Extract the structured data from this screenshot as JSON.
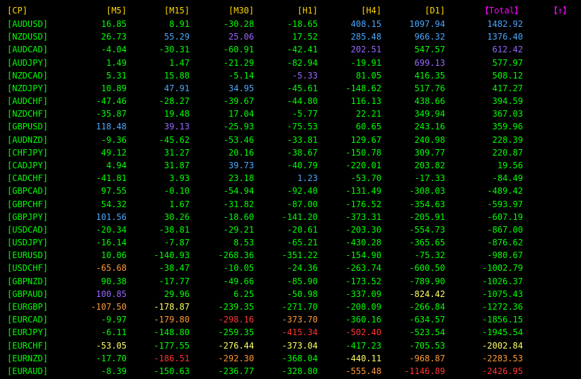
{
  "colors": {
    "header": "#ffd700",
    "symbol": "#00ff00",
    "total_header": "#ff00ff",
    "button": "#ff00ff",
    "strong_up": "#4aa8ff",
    "up": "#9966ff",
    "neutral": "#00ff00",
    "down": "#ffff66",
    "weak_down": "#ff9933",
    "strong_down": "#ff3333"
  },
  "header": {
    "symbol": "[CP]",
    "m5": "[M5]",
    "m15": "[M15]",
    "m30": "[M30]",
    "h1": "[H1]",
    "h4": "[H4]",
    "d1": "[D1]",
    "total": "【Total】",
    "button": "【↑】"
  },
  "rows": [
    {
      "symbol": "[AUDUSD]",
      "m5": "16.85",
      "m15": "8.91",
      "m30": "-30.28",
      "h1": "-18.65",
      "h4": "408.15",
      "d1": "1097.94",
      "total": "1482.92",
      "colors": {
        "m5": "neutral",
        "m15": "neutral",
        "m30": "neutral",
        "h1": "neutral",
        "h4": "strong_up",
        "d1": "strong_up",
        "total": "strong_up"
      }
    },
    {
      "symbol": "[NZDUSD]",
      "m5": "26.73",
      "m15": "55.29",
      "m30": "25.06",
      "h1": "17.52",
      "h4": "285.48",
      "d1": "966.32",
      "total": "1376.40",
      "colors": {
        "m5": "neutral",
        "m15": "strong_up",
        "m30": "up",
        "h1": "neutral",
        "h4": "strong_up",
        "d1": "strong_up",
        "total": "strong_up"
      }
    },
    {
      "symbol": "[AUDCAD]",
      "m5": "-4.04",
      "m15": "-30.31",
      "m30": "-60.91",
      "h1": "-42.41",
      "h4": "202.51",
      "d1": "547.57",
      "total": "612.42",
      "colors": {
        "m5": "neutral",
        "m15": "neutral",
        "m30": "neutral",
        "h1": "neutral",
        "h4": "up",
        "d1": "neutral",
        "total": "up"
      }
    },
    {
      "symbol": "[AUDJPY]",
      "m5": "1.49",
      "m15": "1.47",
      "m30": "-21.29",
      "h1": "-82.94",
      "h4": "-19.91",
      "d1": "699.13",
      "total": "577.97",
      "colors": {
        "m5": "neutral",
        "m15": "neutral",
        "m30": "neutral",
        "h1": "neutral",
        "h4": "neutral",
        "d1": "up",
        "total": "neutral"
      }
    },
    {
      "symbol": "[NZDCAD]",
      "m5": "5.31",
      "m15": "15.88",
      "m30": "-5.14",
      "h1": "-5.33",
      "h4": "81.05",
      "d1": "416.35",
      "total": "508.12",
      "colors": {
        "m5": "neutral",
        "m15": "neutral",
        "m30": "neutral",
        "h1": "up",
        "h4": "neutral",
        "d1": "neutral",
        "total": "neutral"
      }
    },
    {
      "symbol": "[NZDJPY]",
      "m5": "10.89",
      "m15": "47.91",
      "m30": "34.95",
      "h1": "-45.61",
      "h4": "-148.62",
      "d1": "517.76",
      "total": "417.27",
      "colors": {
        "m5": "neutral",
        "m15": "strong_up",
        "m30": "strong_up",
        "h1": "neutral",
        "h4": "neutral",
        "d1": "neutral",
        "total": "neutral"
      }
    },
    {
      "symbol": "[AUDCHF]",
      "m5": "-47.46",
      "m15": "-28.27",
      "m30": "-39.67",
      "h1": "-44.80",
      "h4": "116.13",
      "d1": "438.66",
      "total": "394.59",
      "colors": {
        "m5": "neutral",
        "m15": "neutral",
        "m30": "neutral",
        "h1": "neutral",
        "h4": "neutral",
        "d1": "neutral",
        "total": "neutral"
      }
    },
    {
      "symbol": "[NZDCHF]",
      "m5": "-35.87",
      "m15": "19.48",
      "m30": "17.04",
      "h1": "-5.77",
      "h4": "22.21",
      "d1": "349.94",
      "total": "367.03",
      "colors": {
        "m5": "neutral",
        "m15": "neutral",
        "m30": "neutral",
        "h1": "neutral",
        "h4": "neutral",
        "d1": "neutral",
        "total": "neutral"
      }
    },
    {
      "symbol": "[GBPUSD]",
      "m5": "118.48",
      "m15": "39.13",
      "m30": "-25.93",
      "h1": "-75.53",
      "h4": "60.65",
      "d1": "243.16",
      "total": "359.96",
      "colors": {
        "m5": "strong_up",
        "m15": "up",
        "m30": "neutral",
        "h1": "neutral",
        "h4": "neutral",
        "d1": "neutral",
        "total": "neutral"
      }
    },
    {
      "symbol": "[AUDNZD]",
      "m5": "-9.36",
      "m15": "-45.62",
      "m30": "-53.46",
      "h1": "-33.81",
      "h4": "129.67",
      "d1": "240.98",
      "total": "228.39",
      "colors": {
        "m5": "neutral",
        "m15": "neutral",
        "m30": "neutral",
        "h1": "neutral",
        "h4": "neutral",
        "d1": "neutral",
        "total": "neutral"
      }
    },
    {
      "symbol": "[CHFJPY]",
      "m5": "49.12",
      "m15": "31.27",
      "m30": "20.16",
      "h1": "-38.67",
      "h4": "-150.78",
      "d1": "309.77",
      "total": "220.87",
      "colors": {
        "m5": "neutral",
        "m15": "neutral",
        "m30": "neutral",
        "h1": "neutral",
        "h4": "neutral",
        "d1": "neutral",
        "total": "neutral"
      }
    },
    {
      "symbol": "[CADJPY]",
      "m5": "4.94",
      "m15": "31.87",
      "m30": "39.73",
      "h1": "-40.79",
      "h4": "-220.01",
      "d1": "203.82",
      "total": "19.56",
      "colors": {
        "m5": "neutral",
        "m15": "neutral",
        "m30": "strong_up",
        "h1": "neutral",
        "h4": "neutral",
        "d1": "neutral",
        "total": "neutral"
      }
    },
    {
      "symbol": "[CADCHF]",
      "m5": "-41.81",
      "m15": "3.93",
      "m30": "23.18",
      "h1": "1.23",
      "h4": "-53.70",
      "d1": "-17.33",
      "total": "-84.49",
      "colors": {
        "m5": "neutral",
        "m15": "neutral",
        "m30": "neutral",
        "h1": "strong_up",
        "h4": "neutral",
        "d1": "neutral",
        "total": "neutral"
      }
    },
    {
      "symbol": "[GBPCAD]",
      "m5": "97.55",
      "m15": "-0.10",
      "m30": "-54.94",
      "h1": "-92.40",
      "h4": "-131.49",
      "d1": "-308.03",
      "total": "-489.42",
      "colors": {
        "m5": "neutral",
        "m15": "neutral",
        "m30": "neutral",
        "h1": "neutral",
        "h4": "neutral",
        "d1": "neutral",
        "total": "neutral"
      }
    },
    {
      "symbol": "[GBPCHF]",
      "m5": "54.32",
      "m15": "1.67",
      "m30": "-31.82",
      "h1": "-87.00",
      "h4": "-176.52",
      "d1": "-354.63",
      "total": "-593.97",
      "colors": {
        "m5": "neutral",
        "m15": "neutral",
        "m30": "neutral",
        "h1": "neutral",
        "h4": "neutral",
        "d1": "neutral",
        "total": "neutral"
      }
    },
    {
      "symbol": "[GBPJPY]",
      "m5": "101.56",
      "m15": "30.26",
      "m30": "-18.60",
      "h1": "-141.20",
      "h4": "-373.31",
      "d1": "-205.91",
      "total": "-607.19",
      "colors": {
        "m5": "strong_up",
        "m15": "neutral",
        "m30": "neutral",
        "h1": "neutral",
        "h4": "neutral",
        "d1": "neutral",
        "total": "neutral"
      }
    },
    {
      "symbol": "[USDCAD]",
      "m5": "-20.34",
      "m15": "-38.81",
      "m30": "-29.21",
      "h1": "-20.61",
      "h4": "-203.30",
      "d1": "-554.73",
      "total": "-867.00",
      "colors": {
        "m5": "neutral",
        "m15": "neutral",
        "m30": "neutral",
        "h1": "neutral",
        "h4": "neutral",
        "d1": "neutral",
        "total": "neutral"
      }
    },
    {
      "symbol": "[USDJPY]",
      "m5": "-16.14",
      "m15": "-7.87",
      "m30": "8.53",
      "h1": "-65.21",
      "h4": "-430.28",
      "d1": "-365.65",
      "total": "-876.62",
      "colors": {
        "m5": "neutral",
        "m15": "neutral",
        "m30": "neutral",
        "h1": "neutral",
        "h4": "neutral",
        "d1": "neutral",
        "total": "neutral"
      }
    },
    {
      "symbol": "[EURUSD]",
      "m5": "10.06",
      "m15": "-140.93",
      "m30": "-268.36",
      "h1": "-351.22",
      "h4": "-154.90",
      "d1": "-75.32",
      "total": "-980.67",
      "colors": {
        "m5": "neutral",
        "m15": "neutral",
        "m30": "neutral",
        "h1": "neutral",
        "h4": "neutral",
        "d1": "neutral",
        "total": "neutral"
      }
    },
    {
      "symbol": "[USDCHF]",
      "m5": "-65.68",
      "m15": "-38.47",
      "m30": "-10.05",
      "h1": "-24.36",
      "h4": "-263.74",
      "d1": "-600.50",
      "total": "-1002.79",
      "colors": {
        "m5": "weak_down",
        "m15": "neutral",
        "m30": "neutral",
        "h1": "neutral",
        "h4": "neutral",
        "d1": "neutral",
        "total": "neutral"
      }
    },
    {
      "symbol": "[GBPNZD]",
      "m5": "90.38",
      "m15": "-17.77",
      "m30": "-49.66",
      "h1": "-85.90",
      "h4": "-173.52",
      "d1": "-789.90",
      "total": "-1026.37",
      "colors": {
        "m5": "neutral",
        "m15": "neutral",
        "m30": "neutral",
        "h1": "neutral",
        "h4": "neutral",
        "d1": "neutral",
        "total": "neutral"
      }
    },
    {
      "symbol": "[GBPAUD]",
      "m5": "100.85",
      "m15": "29.96",
      "m30": "6.25",
      "h1": "-50.98",
      "h4": "-337.09",
      "d1": "-824.42",
      "total": "-1075.43",
      "colors": {
        "m5": "up",
        "m15": "neutral",
        "m30": "neutral",
        "h1": "neutral",
        "h4": "neutral",
        "d1": "down",
        "total": "neutral"
      }
    },
    {
      "symbol": "[EURGBP]",
      "m5": "-107.50",
      "m15": "-178.87",
      "m30": "-239.35",
      "h1": "-271.70",
      "h4": "-208.09",
      "d1": "-266.84",
      "total": "-1272.36",
      "colors": {
        "m5": "weak_down",
        "m15": "down",
        "m30": "neutral",
        "h1": "neutral",
        "h4": "neutral",
        "d1": "neutral",
        "total": "neutral"
      }
    },
    {
      "symbol": "[EURCAD]",
      "m5": "-9.97",
      "m15": "-179.80",
      "m30": "-298.16",
      "h1": "-373.70",
      "h4": "-360.16",
      "d1": "-634.57",
      "total": "-1856.15",
      "colors": {
        "m5": "neutral",
        "m15": "weak_down",
        "m30": "strong_down",
        "h1": "weak_down",
        "h4": "neutral",
        "d1": "neutral",
        "total": "neutral"
      }
    },
    {
      "symbol": "[EURJPY]",
      "m5": "-6.11",
      "m15": "-148.80",
      "m30": "-259.35",
      "h1": "-415.34",
      "h4": "-502.40",
      "d1": "-523.54",
      "total": "-1945.54",
      "colors": {
        "m5": "neutral",
        "m15": "neutral",
        "m30": "neutral",
        "h1": "strong_down",
        "h4": "strong_down",
        "d1": "neutral",
        "total": "neutral"
      }
    },
    {
      "symbol": "[EURCHF]",
      "m5": "-53.05",
      "m15": "-177.55",
      "m30": "-276.44",
      "h1": "-373.04",
      "h4": "-417.23",
      "d1": "-705.53",
      "total": "-2002.84",
      "colors": {
        "m5": "down",
        "m15": "neutral",
        "m30": "down",
        "h1": "down",
        "h4": "neutral",
        "d1": "neutral",
        "total": "down"
      }
    },
    {
      "symbol": "[EURNZD]",
      "m5": "-17.70",
      "m15": "-186.51",
      "m30": "-292.30",
      "h1": "-368.04",
      "h4": "-440.11",
      "d1": "-968.87",
      "total": "-2283.53",
      "colors": {
        "m5": "neutral",
        "m15": "strong_down",
        "m30": "weak_down",
        "h1": "neutral",
        "h4": "down",
        "d1": "weak_down",
        "total": "weak_down"
      }
    },
    {
      "symbol": "[EURAUD]",
      "m5": "-8.39",
      "m15": "-150.63",
      "m30": "-236.77",
      "h1": "-328.80",
      "h4": "-555.48",
      "d1": "-1146.89",
      "total": "-2426.95",
      "colors": {
        "m5": "neutral",
        "m15": "neutral",
        "m30": "neutral",
        "h1": "neutral",
        "h4": "weak_down",
        "d1": "strong_down",
        "total": "strong_down"
      }
    }
  ]
}
